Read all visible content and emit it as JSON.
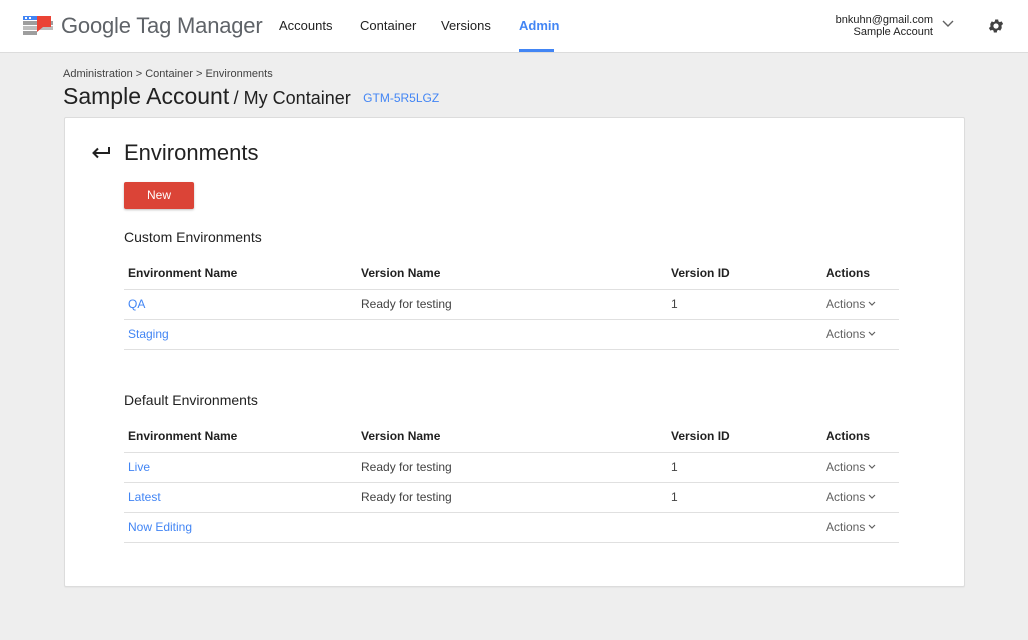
{
  "app": {
    "title": "Google Tag Manager",
    "brand_colors": {
      "accent": "#4285f4",
      "new_button": "#db4437",
      "logo_blue": "#4285f4",
      "logo_red": "#ea4335",
      "logo_grey": "#9e9e9e"
    }
  },
  "nav": {
    "items": [
      {
        "label": "Accounts",
        "active": false
      },
      {
        "label": "Container",
        "active": false
      },
      {
        "label": "Versions",
        "active": false
      },
      {
        "label": "Admin",
        "active": true
      }
    ]
  },
  "account_menu": {
    "email": "bnkuhn@gmail.com",
    "account": "Sample Account",
    "chevron_icon": "chevron-down-icon",
    "settings_icon": "gear-icon"
  },
  "header": {
    "breadcrumb": "Administration > Container > Environments",
    "account_name": "Sample Account",
    "container_name": "/ My Container",
    "container_id": "GTM-5R5LGZ"
  },
  "page": {
    "back_icon": "back-arrow-icon",
    "title": "Environments",
    "new_label": "New"
  },
  "custom_env": {
    "title": "Custom Environments",
    "headers": [
      "Environment Name",
      "Version Name",
      "Version ID",
      "Actions"
    ],
    "rows": [
      {
        "name": "QA",
        "version_name": "Ready for testing",
        "version_id": "1",
        "actions": "Actions"
      },
      {
        "name": "Staging",
        "version_name": "",
        "version_id": "",
        "actions": "Actions"
      }
    ]
  },
  "default_env": {
    "title": "Default Environments",
    "headers": [
      "Environment Name",
      "Version Name",
      "Version ID",
      "Actions"
    ],
    "rows": [
      {
        "name": "Live",
        "version_name": "Ready for testing",
        "version_id": "1",
        "actions": "Actions"
      },
      {
        "name": "Latest",
        "version_name": "Ready for testing",
        "version_id": "1",
        "actions": "Actions"
      },
      {
        "name": "Now Editing",
        "version_name": "",
        "version_id": "",
        "actions": "Actions"
      }
    ]
  }
}
